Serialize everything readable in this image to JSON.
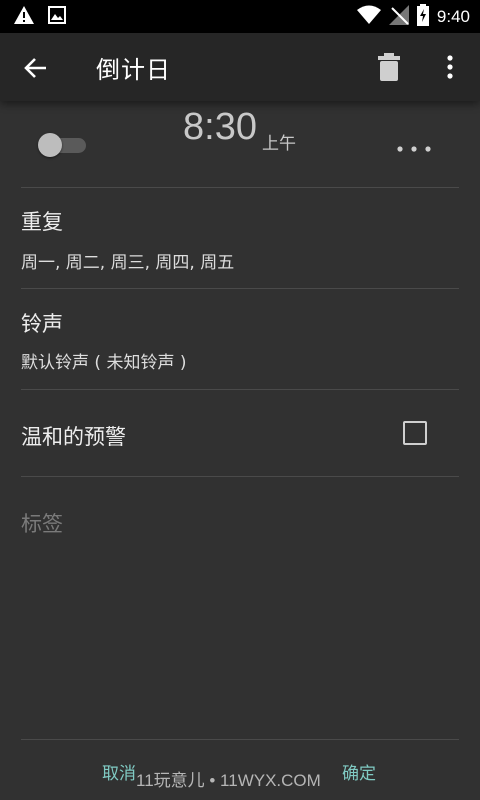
{
  "status_bar": {
    "time": "9:40",
    "icons_left": [
      "warning-icon",
      "image-icon"
    ],
    "icons_right": [
      "wifi-icon",
      "no-signal-icon",
      "battery-charging-icon"
    ]
  },
  "app_bar": {
    "title": "倒计日",
    "back_icon": "back-arrow-icon",
    "delete_icon": "trash-icon",
    "menu_icon": "overflow-menu-icon"
  },
  "alarm": {
    "time": "8:30",
    "ampm": "上午",
    "enabled": false,
    "more_icon": "more-horizontal-icon"
  },
  "repeat": {
    "label": "重复",
    "value": "周一, 周二, 周三, 周四, 周五"
  },
  "ringtone": {
    "label": "铃声",
    "value": "默认铃声 ( 未知铃声 )"
  },
  "gentle_alert": {
    "label": "温和的预警",
    "checked": false
  },
  "tag": {
    "placeholder": "标签"
  },
  "footer": {
    "cancel_label": "取消",
    "confirm_label": "确定",
    "watermark": "11玩意儿 • 11WYX.COM"
  },
  "colors": {
    "background": "#313131",
    "app_bar": "#262626",
    "accent": "#80cbc4"
  }
}
